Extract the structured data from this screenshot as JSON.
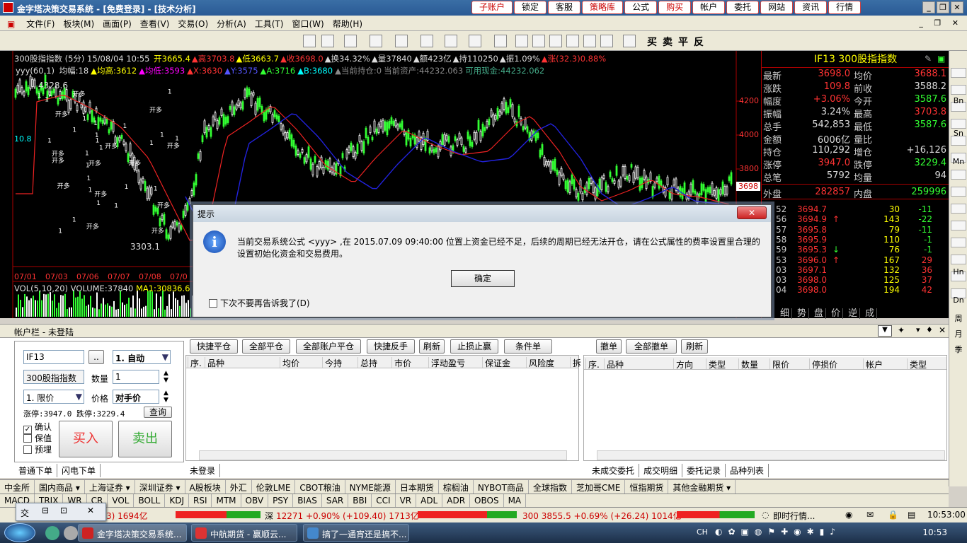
{
  "window": {
    "title": "金字塔决策交易系统 - [免费登录] - [技术分析]",
    "top_buttons": [
      {
        "label": "子账户",
        "red": true
      },
      {
        "label": "锁定",
        "red": false
      },
      {
        "label": "客服",
        "red": false
      },
      {
        "label": "策略库",
        "red": true
      },
      {
        "label": "公式",
        "red": false
      },
      {
        "label": "购买",
        "red": true
      },
      {
        "label": "帐户",
        "red": false
      },
      {
        "label": "委托",
        "red": false
      },
      {
        "label": "网站",
        "red": false
      },
      {
        "label": "资讯",
        "red": false
      },
      {
        "label": "行情",
        "red": false
      }
    ]
  },
  "menu": [
    "文件(F)",
    "板块(M)",
    "画面(P)",
    "查看(V)",
    "交易(O)",
    "分析(A)",
    "工具(T)",
    "窗口(W)",
    "帮助(H)"
  ],
  "toolbar_chars": [
    "买",
    "卖",
    "平",
    "反"
  ],
  "chart": {
    "header1": "300股指指数 (5分) 15/08/04 10:55",
    "header1_items": [
      {
        "t": "开3665.4",
        "c": "#ff0"
      },
      {
        "t": "▲高3703.8",
        "c": "#f33"
      },
      {
        "t": "▲低3663.7",
        "c": "#ff0"
      },
      {
        "t": "▲收3698.0",
        "c": "#f33"
      },
      {
        "t": "▲换34.32%",
        "c": "#ddd"
      },
      {
        "t": "▲量37840",
        "c": "#ddd"
      },
      {
        "t": "▲额423亿",
        "c": "#ddd"
      },
      {
        "t": "▲持110250",
        "c": "#ddd"
      },
      {
        "t": "▲振1.09%",
        "c": "#ddd"
      },
      {
        "t": "▲涨(32.3)0.88%",
        "c": "#f33"
      }
    ],
    "header2_label": "yyy(60,1)",
    "header2_items": [
      {
        "t": "均幅:18",
        "c": "#ddd"
      },
      {
        "t": "▲均高:3612",
        "c": "#ff0"
      },
      {
        "t": "▲均低:3593",
        "c": "#f0f"
      },
      {
        "t": "▲X:3630",
        "c": "#f33"
      },
      {
        "t": "▲Y:3575",
        "c": "#55f"
      },
      {
        "t": "▲A:3716",
        "c": "#3f3"
      },
      {
        "t": "▲B:3680",
        "c": "#0ff"
      },
      {
        "t": "▲当前持仓:0",
        "c": "#888"
      },
      {
        "t": "当前资产:44232.063",
        "c": "#888"
      },
      {
        "t": "可用现金:44232.062",
        "c": "#4a8"
      }
    ],
    "price_labels": [
      "4200",
      "4000",
      "3800"
    ],
    "current_price_tag": "3698",
    "left_value": "10.8",
    "high_mark": "4328.6",
    "low_mark": "3303.1",
    "dates": [
      "07/01",
      "07/03",
      "07/06",
      "07/07",
      "07/08",
      "07/0"
    ],
    "vol_label": "VOL(5,10,20)",
    "vol_value": "VOLUME:37840",
    "vol_ma": "MA1:30836.6"
  },
  "quote": {
    "title": "IF13  300股指指数",
    "rows": [
      {
        "l": "最新",
        "v": "3698.0",
        "vc": "red",
        "l2": "均价",
        "v2": "3688.1",
        "v2c": "red"
      },
      {
        "l": "涨跌",
        "v": "109.8",
        "vc": "red",
        "l2": "前收",
        "v2": "3588.2",
        "v2c": "wht"
      },
      {
        "l": "幅度",
        "v": "+3.06%",
        "vc": "red",
        "l2": "今开",
        "v2": "3587.6",
        "v2c": "grn"
      },
      {
        "l": "振幅",
        "v": "3.24%",
        "vc": "wht",
        "l2": "最高",
        "v2": "3703.8",
        "v2c": "red"
      },
      {
        "l": "总手",
        "v": "542,853",
        "vc": "wht",
        "l2": "最低",
        "v2": "3587.6",
        "v2c": "grn"
      },
      {
        "l": "金额",
        "v": "6006亿",
        "vc": "wht",
        "l2": "量比",
        "v2": "",
        "v2c": "wht"
      },
      {
        "l": "持仓",
        "v": "110,292",
        "vc": "wht",
        "l2": "增仓",
        "v2": "+16,126",
        "v2c": "wht"
      },
      {
        "l": "涨停",
        "v": "3947.0",
        "vc": "red",
        "l2": "跌停",
        "v2": "3229.4",
        "v2c": "grn"
      },
      {
        "l": "总笔",
        "v": "5792",
        "vc": "wht",
        "l2": "均量",
        "v2": "94",
        "v2c": "wht"
      }
    ],
    "outer_label": "外盘",
    "outer_val": "282857",
    "inner_label": "内盘",
    "inner_val": "259996",
    "ticks": [
      {
        "t": "52",
        "p": "3694.7",
        "a": "",
        "v": "30",
        "d": "-11"
      },
      {
        "t": "56",
        "p": "3694.9",
        "a": "↑",
        "v": "143",
        "d": "-22"
      },
      {
        "t": "57",
        "p": "3695.8",
        "a": "",
        "v": "79",
        "d": "-11"
      },
      {
        "t": "58",
        "p": "3695.9",
        "a": "",
        "v": "110",
        "d": "-1"
      },
      {
        "t": "59",
        "p": "3695.3",
        "a": "↓",
        "v": "76",
        "d": "-1"
      },
      {
        "t": "53",
        "p": "3696.0",
        "a": "↑",
        "v": "167",
        "d": "29"
      },
      {
        "t": "03",
        "p": "3697.1",
        "a": "",
        "v": "132",
        "d": "36"
      },
      {
        "t": "03",
        "p": "3698.0",
        "a": "",
        "v": "125",
        "d": "37"
      },
      {
        "t": "04",
        "p": "3698.0",
        "a": "",
        "v": "194",
        "d": "42"
      }
    ],
    "tick_tabs": [
      "细",
      "势",
      "盘",
      "价",
      "逆",
      "成"
    ]
  },
  "right_sidebar": [
    "Bn",
    "Sn",
    "Mn",
    "Hn",
    "Dn",
    "周",
    "月",
    "季"
  ],
  "dialog": {
    "title": "提示",
    "message": "当前交易系统公式 <yyy> ,在 2015.07.09 09:40:00 位置上资金已经不足，后续的周期已经无法开仓，请在公式属性的费率设置里合理的设置初始化资金和交易费用。",
    "ok": "确定",
    "checkbox": "下次不要再告诉我了(D)"
  },
  "account": {
    "bar_title": "帐户栏 - 未登陆",
    "code": "IF13",
    "code_btn": "..",
    "mode": "1. 自动",
    "name": "300股指指数",
    "qty_label": "数量",
    "qty": "1",
    "price_type": "1. 限价",
    "price_label": "价格",
    "price": "对手价",
    "limit_text": "涨停:3947.0 跌停:3229.4",
    "query_btn": "查询",
    "checks": [
      "确认",
      "保值",
      "预埋"
    ],
    "buy": "买入",
    "sell": "卖出",
    "order_tabs": [
      "普通下单",
      "闪电下单"
    ],
    "pos_buttons": [
      "快捷平仓",
      "全部平仓",
      "全部账户平仓",
      "快捷反手",
      "刷新",
      "止损止赢",
      "条件单"
    ],
    "pos_cols": [
      "序.",
      "品种",
      "均价",
      "今持",
      "总持",
      "市价",
      "浮动盈亏",
      "保证金",
      "风险度",
      "拆"
    ],
    "pos_tab": "未登录",
    "ord_buttons": [
      "撤单",
      "全部撤单",
      "刷新"
    ],
    "ord_cols": [
      "序.",
      "品种",
      "方向",
      "类型",
      "数量",
      "限价",
      "停损价",
      "帐户",
      "类型"
    ],
    "ord_tabs": [
      "未成交委托",
      "成交明细",
      "委托记录",
      "品种列表"
    ]
  },
  "markets": [
    "中金所",
    "国内商品 ▾",
    "上海证券 ▾",
    "深圳证券 ▾",
    "A股板块",
    "外汇",
    "伦敦LME",
    "CBOT粮油",
    "NYME能源",
    "日本期货",
    "棕榈油",
    "NYBOT商品",
    "全球指数",
    "芝加哥CME",
    "恒指期货",
    "其他金融期货 ▾"
  ],
  "indicators": [
    "MACD",
    "TRIX",
    "WR",
    "CR",
    "VOL",
    "BOLL",
    "KDJ",
    "RSI",
    "MTM",
    "OBV",
    "PSY",
    "BIAS",
    "SAR",
    "BBI",
    "CCI",
    "VR",
    "ADL",
    "ADR",
    "OBOS",
    "MA"
  ],
  "status": {
    "s1": "3)  1694亿",
    "s2_label": "深",
    "s2": "12271 +0.90% (+109.40)  1713亿",
    "s3": "300  3855.5 +0.69% (+26.24)  1014亿",
    "info": "即时行情...",
    "time": "10:53:00"
  },
  "floatwin": {
    "label": "交"
  },
  "taskbar": {
    "tasks": [
      "金字塔决策交易系统...",
      "中航期货 - 赢顺云...",
      "搞了一通宵还是搞不..."
    ],
    "lang": "CH",
    "clock": "10:53"
  }
}
